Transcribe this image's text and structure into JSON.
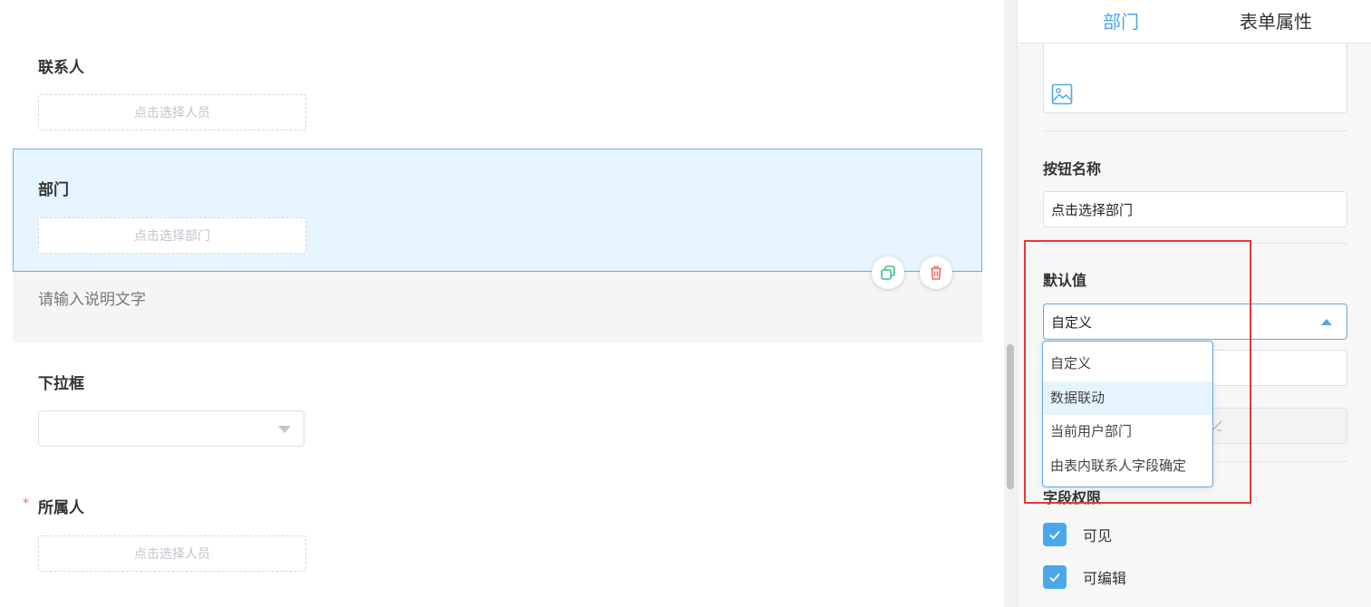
{
  "canvas": {
    "contact": {
      "label": "联系人",
      "button": "点击选择人员"
    },
    "department": {
      "label": "部门",
      "button": "点击选择部门",
      "description_placeholder": "请输入说明文字"
    },
    "dropdown_field": {
      "label": "下拉框",
      "value": ""
    },
    "owner": {
      "label": "所属人",
      "required_mark": "*",
      "button": "点击选择人员"
    }
  },
  "panel": {
    "tabs": [
      {
        "label": "部门",
        "active": true
      },
      {
        "label": "表单属性",
        "active": false
      }
    ],
    "button_name": {
      "label": "按钮名称",
      "value": "点击选择部门"
    },
    "default_value": {
      "label": "默认值",
      "selected": "自定义",
      "options": [
        "自定义",
        "数据联动",
        "当前用户部门",
        "由表内联系人字段确定"
      ],
      "hovered_option": "数据联动"
    },
    "permissions": {
      "label": "字段权限",
      "items": [
        {
          "label": "可见",
          "checked": true
        },
        {
          "label": "可编辑",
          "checked": true
        }
      ]
    }
  },
  "colors": {
    "accent": "#4aa8e8",
    "highlight": "#e53935",
    "delete": "#f56c6c",
    "copy": "#3cbf8e"
  }
}
